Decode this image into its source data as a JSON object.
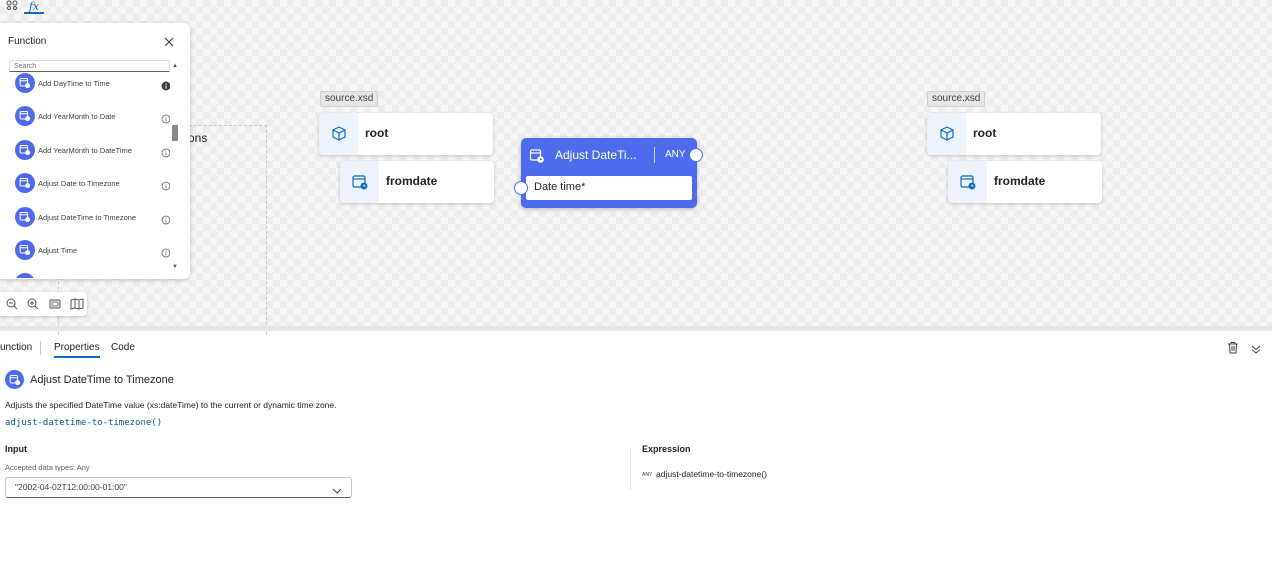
{
  "top_tabs": {
    "schema_icon": "schema-icon",
    "function_label": "fx"
  },
  "function_panel": {
    "title": "Function",
    "search_placeholder": "Search",
    "items": [
      {
        "label": "Add DayTime to Time",
        "info": "info-filled-icon"
      },
      {
        "label": "Add YearMonth to Date",
        "info": "info-icon"
      },
      {
        "label": "Add YearMonth to DateTime",
        "info": "info-icon"
      },
      {
        "label": "Adjust Date to Timezone",
        "info": "info-icon"
      },
      {
        "label": "Adjust DateTime to Timezone",
        "info": "info-icon"
      },
      {
        "label": "Adjust Time",
        "info": "info-icon"
      }
    ]
  },
  "canvas": {
    "partial_label": "ons",
    "source_schema": {
      "tag": "source.xsd",
      "root": "root",
      "child": "fromdate"
    },
    "target_schema": {
      "tag": "source.xsd",
      "root": "root",
      "child": "fromdate"
    },
    "function_node": {
      "title": "Adjust DateTi...",
      "type": "ANY",
      "input_label": "Date time*"
    }
  },
  "bottom_panel": {
    "tabs": {
      "function": "unction",
      "properties": "Properties",
      "code": "Code"
    },
    "function_name": "Adjust DateTime to Timezone",
    "description": "Adjusts the specified DateTime value (xs:dateTime) to the current or dynamic time zone.",
    "signature": "adjust-datetime-to-timezone()",
    "input": {
      "heading": "Input",
      "accepted_types": "Accepted data types: Any",
      "value": "\"2002-04-02T12:00:00-01:00\""
    },
    "expression": {
      "heading": "Expression",
      "type_badge": "ANY",
      "value": "adjust-datetime-to-timezone()"
    }
  },
  "colors": {
    "accent": "#4f6bed",
    "link": "#0f6cbd"
  }
}
